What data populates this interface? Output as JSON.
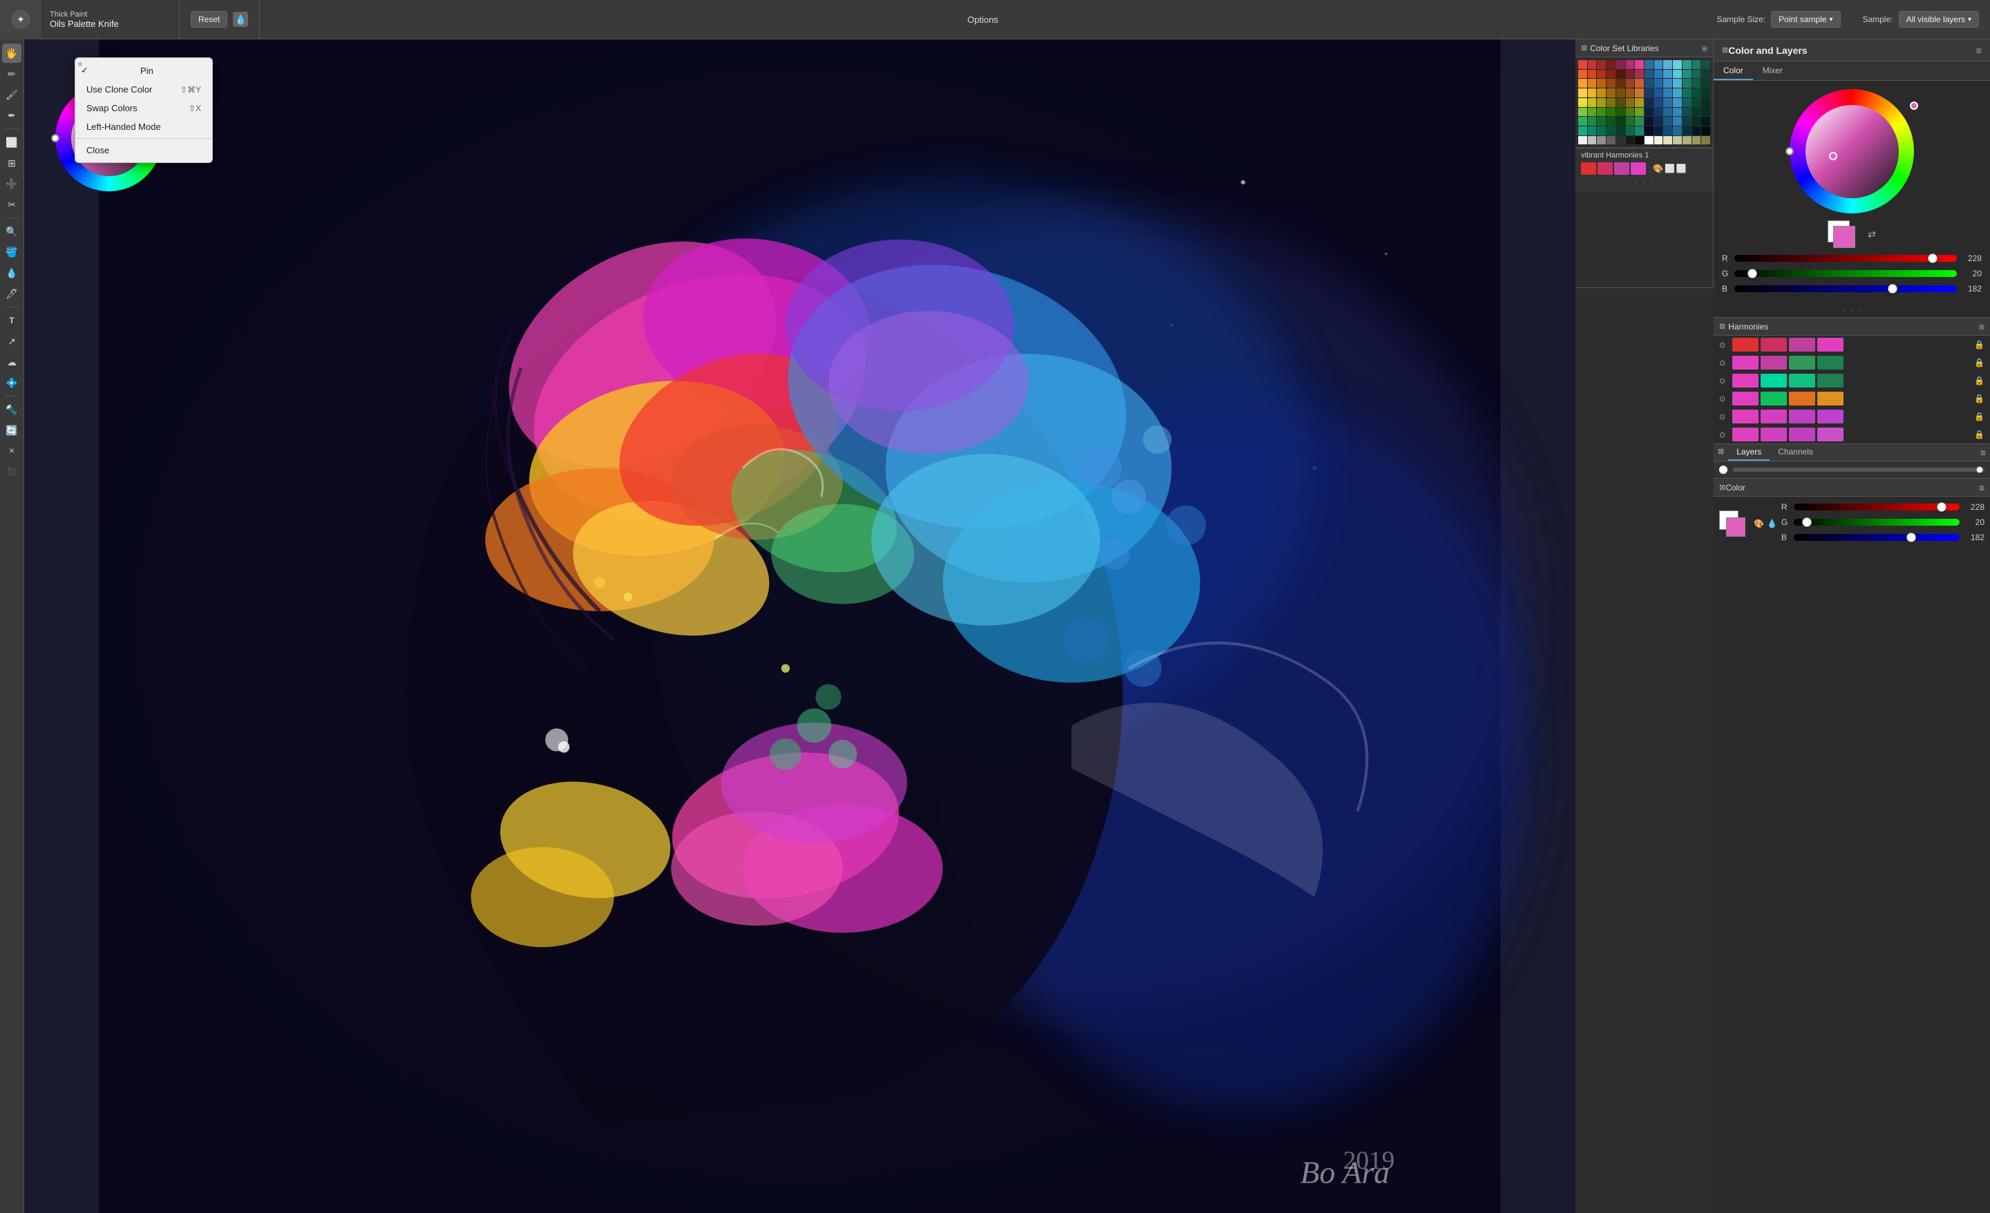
{
  "toolbar": {
    "app_icon": "✦",
    "brush_main": "Thick Paint",
    "brush_sub": "Oils Palette Knife",
    "reset_label": "Reset",
    "options_label": "Options",
    "sample_size_label": "Sample Size:",
    "sample_size_value": "Point sample",
    "sample_label": "Sample:",
    "sample_value": "All visible layers"
  },
  "context_menu": {
    "hamburger_tooltip": "menu",
    "items": [
      {
        "id": "pin",
        "label": "Pin",
        "checked": true,
        "shortcut": ""
      },
      {
        "id": "use-clone-color",
        "label": "Use Clone Color",
        "checked": false,
        "shortcut": "⇧⌘Y"
      },
      {
        "id": "swap-colors",
        "label": "Swap Colors",
        "checked": false,
        "shortcut": "⇧X"
      },
      {
        "id": "left-handed-mode",
        "label": "Left-Handed Mode",
        "checked": false,
        "shortcut": ""
      },
      {
        "id": "close",
        "label": "Close",
        "checked": false,
        "shortcut": ""
      }
    ]
  },
  "left_tools": [
    "🖐",
    "✏️",
    "🖌",
    "✒️",
    "⬜",
    "🔲",
    "➕",
    "✂️",
    "🔍",
    "🪣",
    "💧",
    "🖊",
    "T",
    "↗",
    "☁",
    "🔮",
    "🔦",
    "🔄",
    "❌",
    "⬛"
  ],
  "color_set_panel": {
    "title": "Color Set Libraries",
    "swatches": [
      "#e8453c",
      "#c73434",
      "#a02828",
      "#7a1c1c",
      "#8b2252",
      "#b52d72",
      "#e0408f",
      "#2d6e9e",
      "#3a8fcf",
      "#56b4d8",
      "#6ed0e0",
      "#2e9e8f",
      "#1f7a6b",
      "#164f45",
      "#f0602a",
      "#d94520",
      "#b03218",
      "#882010",
      "#5a1408",
      "#7a2030",
      "#a83050",
      "#1e5a8a",
      "#2878b8",
      "#3ea0d0",
      "#58c8e0",
      "#20907a",
      "#166858",
      "#0e4035",
      "#f8a030",
      "#e08020",
      "#c06010",
      "#984808",
      "#6a3005",
      "#a04020",
      "#d06030",
      "#1a4e78",
      "#2268a8",
      "#3890c8",
      "#50b8d8",
      "#188068",
      "#106048",
      "#084030",
      "#ffd040",
      "#e8b828",
      "#c89010",
      "#a06808",
      "#785005",
      "#9a5818",
      "#c87830",
      "#163a60",
      "#1e5898",
      "#2e80b8",
      "#46a8d0",
      "#107060",
      "#0a5038",
      "#063828",
      "#e8e040",
      "#c8c020",
      "#a0a010",
      "#787808",
      "#505005",
      "#8a7010",
      "#b89820",
      "#122850",
      "#1a4888",
      "#2870a8",
      "#3e98c8",
      "#0e6058",
      "#084830",
      "#043020",
      "#80c840",
      "#60a820",
      "#409010",
      "#287808",
      "#186005",
      "#4a8010",
      "#68a820",
      "#0e1e40",
      "#163870",
      "#206898",
      "#3488b8",
      "#0c5050",
      "#063828",
      "#023020",
      "#28b060",
      "#189040",
      "#0e7028",
      "#085818",
      "#044010",
      "#1a7030",
      "#289050",
      "#0a1230",
      "#102858",
      "#1a5888",
      "#3080b0",
      "#0a4048",
      "#043020",
      "#021818",
      "#18a888",
      "#0e8868",
      "#087050",
      "#045838",
      "#024028",
      "#0e6848",
      "#1a8868",
      "#060c20",
      "#0a1c48",
      "#144878",
      "#2068a0",
      "#083040",
      "#021820",
      "#010e10",
      "#f0f0f0",
      "#c0c0c0",
      "#909090",
      "#606060",
      "#303030",
      "#181818",
      "#080808",
      "#ffffff",
      "#f0f0e0",
      "#e0e0c0",
      "#c8c8a0",
      "#b0b080",
      "#989860",
      "#808040"
    ],
    "harmony_label": "vibrant Harmonies 1",
    "harmony_colors": [
      "#e03030",
      "#d03060",
      "#c040a0",
      "#e040c0"
    ]
  },
  "main_panel": {
    "title": "Color and Layers",
    "tab_color": "Color",
    "tab_mixer": "Mixer",
    "rgb": {
      "r_label": "R",
      "g_label": "G",
      "b_label": "B",
      "r_value": 228,
      "g_value": 20,
      "b_value": 182,
      "r_pct": 89,
      "g_pct": 8,
      "b_pct": 71
    }
  },
  "harmonies_panel": {
    "title": "Harmonies",
    "rows": [
      {
        "colors": [
          "#e03030",
          "#cc3060",
          "#c040a0",
          "#e040c0"
        ],
        "locked": false
      },
      {
        "colors": [
          "#e040c0",
          "#c040a0",
          "#309858",
          "#208050"
        ],
        "locked": false
      },
      {
        "colors": [
          "#e040c0",
          "#00d8a0",
          "#10c080",
          "#208050"
        ],
        "locked": false
      },
      {
        "colors": [
          "#e040c0",
          "#10c060",
          "#e07020",
          "#e09020"
        ],
        "locked": false
      },
      {
        "colors": [
          "#e040c0",
          "#d040c0",
          "#c040c0",
          "#c040d0"
        ],
        "locked": false
      },
      {
        "colors": [
          "#e040c0",
          "#d040c0",
          "#c040c0",
          "#c850c8"
        ],
        "locked": false
      }
    ]
  },
  "layers_panel": {
    "tab_layers": "Layers",
    "tab_channels": "Channels"
  },
  "bottom_color": {
    "title": "Color",
    "r_value": 228,
    "g_value": 20,
    "b_value": 182,
    "r_pct": 89,
    "g_pct": 8,
    "b_pct": 71
  },
  "artist_signature": "Bo Ara",
  "year": "2019"
}
